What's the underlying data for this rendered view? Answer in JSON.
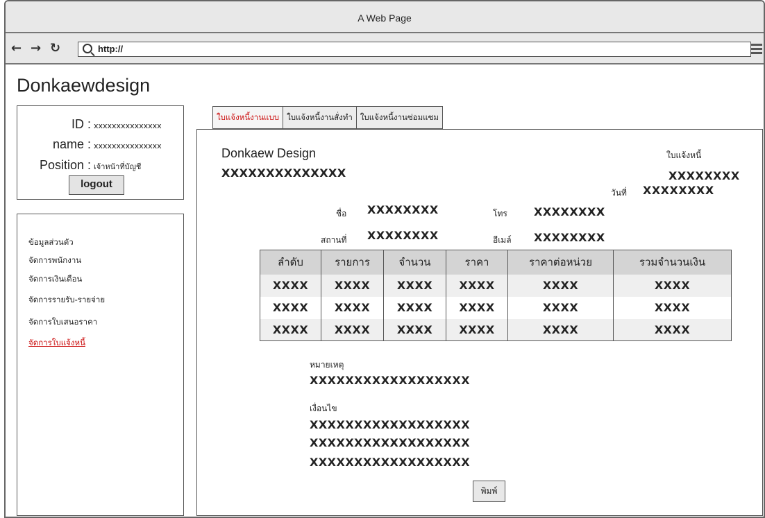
{
  "window": {
    "title": "A Web Page"
  },
  "browser": {
    "url": "http://"
  },
  "brand": "Donkaewdesign",
  "user": {
    "id_label": "ID :",
    "id_value": "xxxxxxxxxxxxxxx",
    "name_label": "name :",
    "name_value": "xxxxxxxxxxxxxxx",
    "position_label": "Position :",
    "position_value": "เจ้าหน้าที่บัญชี",
    "logout_label": "logout"
  },
  "sidebar": {
    "items": [
      {
        "label": "ข้อมูลส่วนตัว",
        "active": false
      },
      {
        "label": "จัดการพนักงาน",
        "active": false
      },
      {
        "label": "จัดการเงินเดือน",
        "active": false
      },
      {
        "label": "จัดการรายรับ-รายจ่าย",
        "active": false
      },
      {
        "label": "จัดการใบเสนอราคา",
        "active": false
      },
      {
        "label": "จัดการใบแจ้งหนี้",
        "active": true
      }
    ]
  },
  "tabs": [
    {
      "label": "ใบแจ้งหนี้งานแบบ",
      "active": true
    },
    {
      "label": "ใบแจ้งหนี้งานสั่งทำ",
      "active": false
    },
    {
      "label": "ใบแจ้งหนี้งานซ่อมแซม",
      "active": false
    }
  ],
  "invoice": {
    "company_name": "Donkaew Design",
    "company_detail": "XXXXXXXXXXXXXX",
    "doc_title": "ใบแจ้งหนี้",
    "doc_number": "XXXXXXXX",
    "date_label": "วันที่",
    "date_value": "XXXXXXXX",
    "customer_name_label": "ชื่อ",
    "customer_name_value": "XXXXXXXX",
    "phone_label": "โทร",
    "phone_value": "XXXXXXXX",
    "address_label": "สถานที่",
    "address_value": "XXXXXXXX",
    "email_label": "อีเมล์",
    "email_value": "XXXXXXXX",
    "table": {
      "headers": [
        "ลำดับ",
        "รายการ",
        "จำนวน",
        "ราคา",
        "ราคาต่อหน่วย",
        "รวมจำนวนเงิน"
      ],
      "rows": [
        [
          "XXXX",
          "XXXX",
          "XXXX",
          "XXXX",
          "XXXX",
          "XXXX"
        ],
        [
          "XXXX",
          "XXXX",
          "XXXX",
          "XXXX",
          "XXXX",
          "XXXX"
        ],
        [
          "XXXX",
          "XXXX",
          "XXXX",
          "XXXX",
          "XXXX",
          "XXXX"
        ]
      ]
    },
    "note_label": "หมายเหตุ",
    "note_value": "XXXXXXXXXXXXXXXXXX",
    "conditions_label": "เงื่อนไข",
    "conditions": [
      "XXXXXXXXXXXXXXXXXX",
      "XXXXXXXXXXXXXXXXXX",
      "XXXXXXXXXXXXXXXXXX"
    ],
    "print_label": "พิมพ์"
  }
}
